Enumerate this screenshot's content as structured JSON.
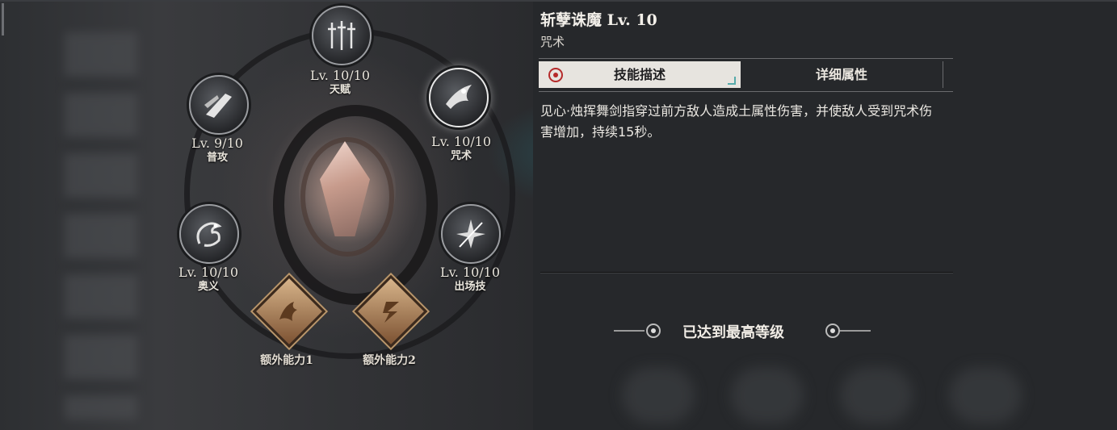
{
  "skill_detail": {
    "title": "斩孽诛魔 Lv. 10",
    "category": "咒术",
    "tabs": [
      {
        "label": "技能描述",
        "active": true
      },
      {
        "label": "详细属性",
        "active": false
      }
    ],
    "description": "见心·烛挥舞剑指穿过前方敌人造成土属性伤害，并使敌人受到咒术伤害增加，持续15秒。",
    "max_level_text": "已达到最高等级"
  },
  "skill_wheel": {
    "nodes": [
      {
        "level": "Lv. 10/10",
        "name": "天赋",
        "icon": "swords-icon"
      },
      {
        "level": "Lv. 9/10",
        "name": "普攻",
        "icon": "blade-strike-icon"
      },
      {
        "level": "Lv. 10/10",
        "name": "咒术",
        "icon": "spell-figure-icon"
      },
      {
        "level": "Lv. 10/10",
        "name": "奥义",
        "icon": "dragon-icon"
      },
      {
        "level": "Lv. 10/10",
        "name": "出场技",
        "icon": "shatter-icon"
      }
    ],
    "extras": [
      {
        "name": "额外能力1",
        "icon": "phoenix-icon"
      },
      {
        "name": "额外能力2",
        "icon": "lightning-rune-icon"
      }
    ],
    "center_icon": "crystal-eye-icon"
  },
  "colors": {
    "active_tab_bg": "#e7e4df",
    "pin_red": "#b52a2a",
    "gold_diamond": "#d7b48a"
  }
}
